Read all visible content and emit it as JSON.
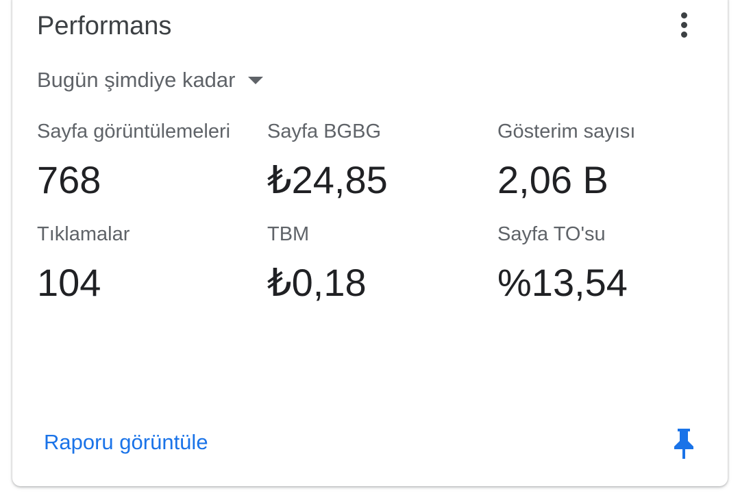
{
  "card": {
    "title": "Performans",
    "more_icon": "more-vert-icon",
    "range": {
      "selected": "Bugün şimdiye kadar",
      "icon": "dropdown-caret-icon"
    },
    "metrics": [
      {
        "label": "Sayfa görüntülemeleri",
        "value": "768"
      },
      {
        "label": "Sayfa BGBG",
        "value": "₺24,85"
      },
      {
        "label": "Gösterim sayısı",
        "value": "2,06 B"
      },
      {
        "label": "Tıklamalar",
        "value": "104"
      },
      {
        "label": "TBM",
        "value": "₺0,18"
      },
      {
        "label": "Sayfa TO'su",
        "value": "%13,54"
      }
    ],
    "footer": {
      "link_label": "Raporu görüntüle",
      "pin_icon": "pin-icon"
    }
  },
  "colors": {
    "accent": "#1a73e8",
    "title_text": "#3c4043",
    "secondary_text": "#5f6368",
    "value_text": "#202124"
  }
}
